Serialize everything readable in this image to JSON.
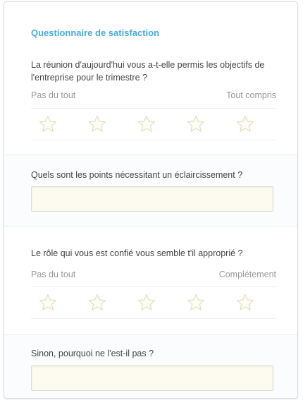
{
  "form": {
    "title": "Questionnaire de satisfaction",
    "accent_color": "#4aabdd",
    "q1": {
      "text": "La réunion d'aujourd'hui vous a-t-elle permis les objectifs de l'entreprise pour le trimestre ?",
      "min_label": "Pas du tout",
      "max_label": "Tout compris",
      "rating": 0,
      "max_rating": 5
    },
    "q2": {
      "text": "Quels sont les points nécessitant un éclaircissement ?",
      "value": ""
    },
    "q3": {
      "text": "Le rôle qui vous est confié vous semble t'il approprié ?",
      "min_label": "Pas du tout",
      "max_label": "Complétement",
      "rating": 0,
      "max_rating": 5
    },
    "q4": {
      "text": "Sinon, pourquoi ne l'est-il pas ?",
      "value": ""
    }
  }
}
